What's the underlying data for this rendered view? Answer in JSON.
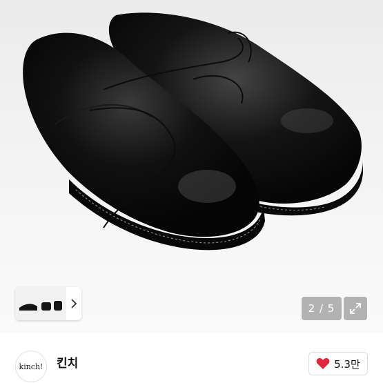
{
  "gallery": {
    "page_indicator": "2 / 5",
    "current_page": 2,
    "total_pages": 5,
    "thumbnail_next_icon": "chevron-right-icon",
    "expand_icon": "expand-icon"
  },
  "store": {
    "avatar_text": "kinch!",
    "name": "킨치"
  },
  "like": {
    "icon": "heart-icon",
    "count": "5.3만",
    "color": "#e0263a"
  }
}
